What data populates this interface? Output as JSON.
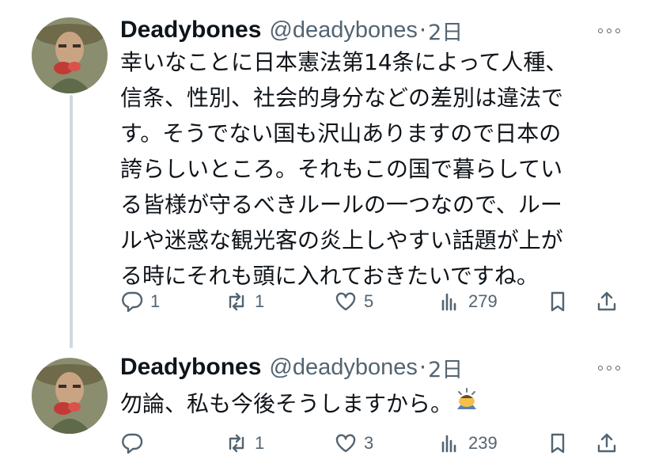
{
  "tweets": [
    {
      "name": "Deadybones",
      "handle": "@deadybones",
      "separator": "·",
      "time": "2日",
      "text": "幸いなことに日本憲法第14条によって人種、\n信条、性別、社会的身分などの差別は違法で\nす。そうでない国も沢山ありますので日本の\n誇らしいところ。それもこの国で暮らしてい\nる皆様が守るべきルールの一つなので、ルー\nルや迷惑な観光客の炎上しやすい話題が上が\nる時にそれも頭に入れておきたいですね。",
      "replies": "1",
      "retweets": "1",
      "likes": "5",
      "views": "279"
    },
    {
      "name": "Deadybones",
      "handle": "@deadybones",
      "separator": "·",
      "time": "2日",
      "text": "勿論、私も今後そうしますから。",
      "emoji": "person-bowing-emoji",
      "replies": "",
      "retweets": "1",
      "likes": "3",
      "views": "239"
    }
  ],
  "icons": {
    "reply": "reply-icon",
    "retweet": "retweet-icon",
    "like": "heart-icon",
    "views": "views-icon",
    "bookmark": "bookmark-icon",
    "share": "share-icon",
    "more": "more-icon"
  },
  "colors": {
    "text": "#0f1419",
    "muted": "#536471",
    "thread_line": "#cfd9de"
  }
}
